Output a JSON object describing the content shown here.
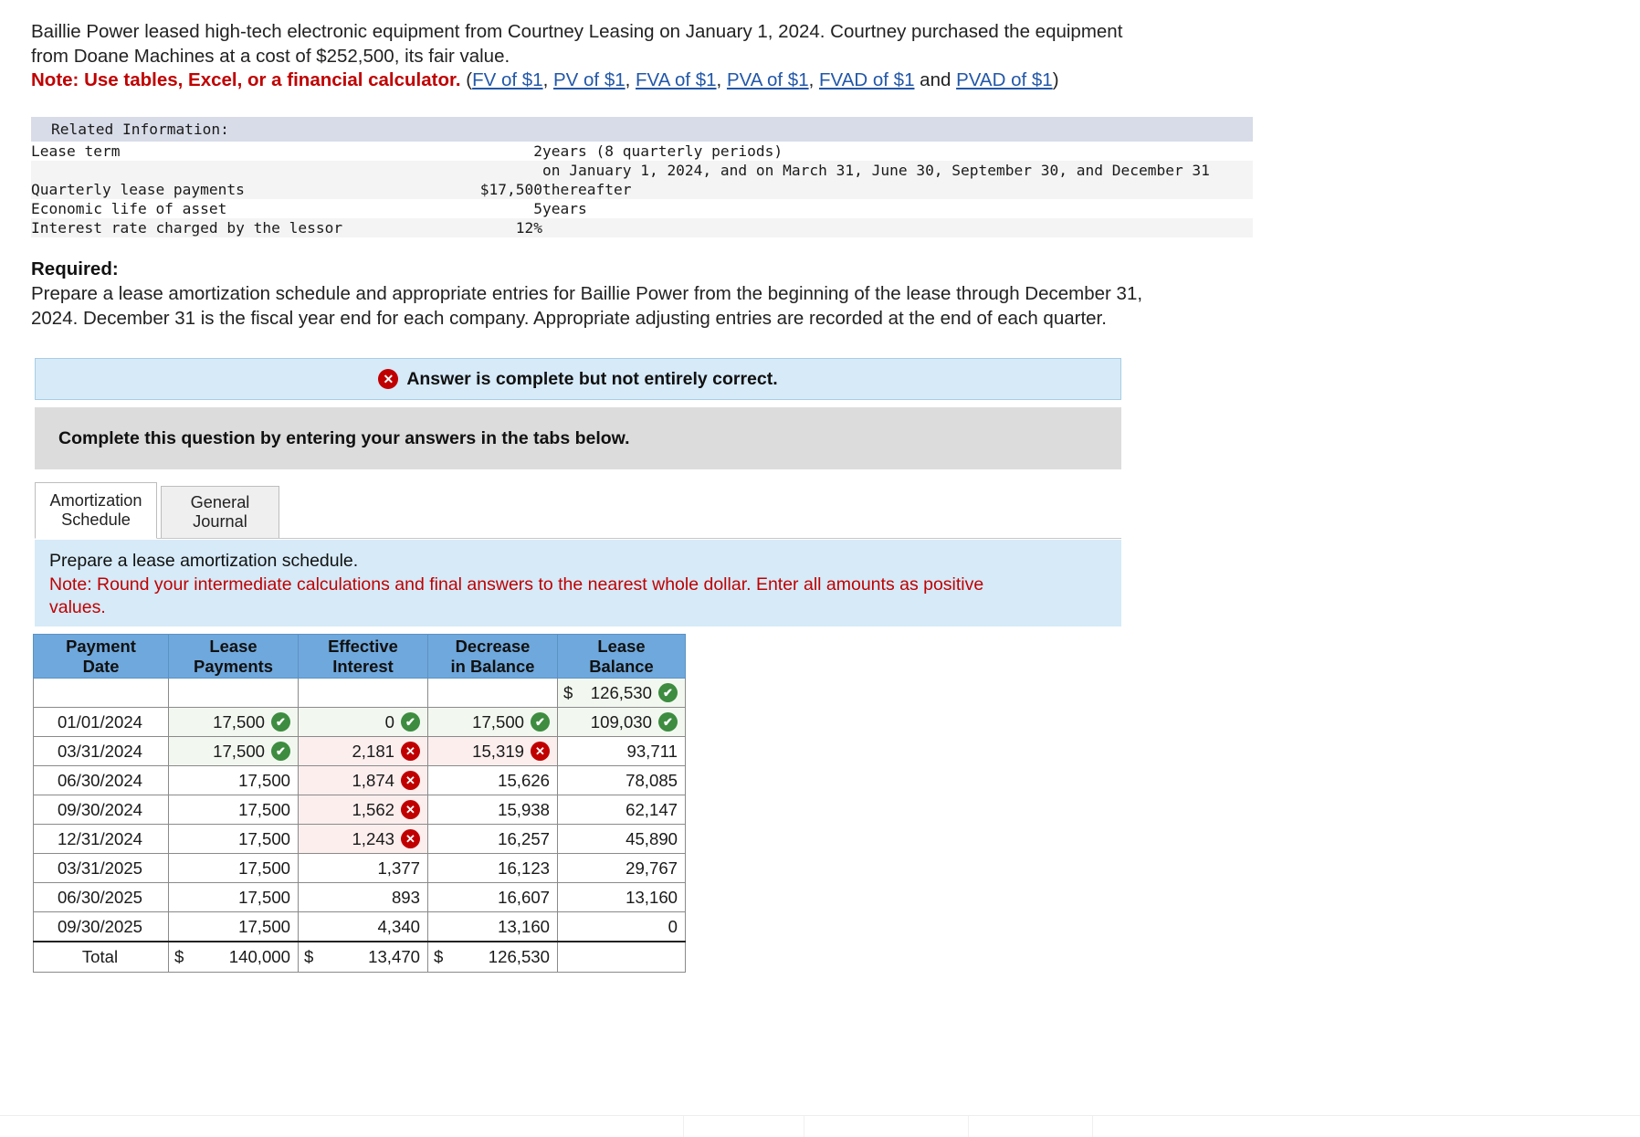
{
  "intro": {
    "line1": "Baillie Power leased high-tech electronic equipment from Courtney Leasing on January 1, 2024. Courtney purchased the equipment",
    "line2": "from Doane Machines at a cost of $252,500, its fair value.",
    "note_label": "Note: Use tables, Excel, or a financial calculator.",
    "paren_open": "(",
    "paren_close": ")",
    "and_text": " and ",
    "links": [
      "FV of $1",
      "PV of $1",
      "FVA of $1",
      "PVA of $1",
      "FVAD of $1",
      "PVAD of $1"
    ],
    "link_color": "#2257a8",
    "note_color": "#c00000"
  },
  "related_information": {
    "title": "Related Information:",
    "rows": [
      {
        "label": "Lease term",
        "amount": "2",
        "rest": "years (8 quarterly periods)"
      },
      {
        "label": "",
        "amount": "",
        "rest": "on January 1, 2024, and on March 31, June 30, September 30, and December 31"
      },
      {
        "label": "Quarterly lease payments",
        "amount": "$17,500",
        "rest": "thereafter"
      },
      {
        "label": "Economic life of asset",
        "amount": "5",
        "rest": "years"
      },
      {
        "label": "Interest rate charged by the lessor",
        "amount": "12%",
        "rest": ""
      }
    ]
  },
  "required": {
    "heading": "Required:",
    "line1": "Prepare a lease amortization schedule and appropriate entries for Baillie Power from the beginning of the lease through December 31,",
    "line2": "2024. December 31 is the fiscal year end for each company. Appropriate adjusting entries are recorded at the end of each quarter."
  },
  "answer_banner": {
    "icon": "x-circle-icon",
    "text": "Answer is complete but not entirely correct.",
    "background": "#d6eaf8",
    "icon_color": "#c00000"
  },
  "complete_bar": {
    "text": "Complete this question by entering your answers in the tabs below."
  },
  "tabs": [
    {
      "label_line1": "Amortization",
      "label_line2": "Schedule",
      "active": true
    },
    {
      "label_line1": "General",
      "label_line2": "Journal",
      "active": false
    }
  ],
  "prompt": {
    "line1": "Prepare a lease amortization schedule.",
    "line2": "Note: Round your intermediate calculations and final answers to the nearest whole dollar. Enter all amounts as positive",
    "line3": "values."
  },
  "amortization_table": {
    "headers": [
      {
        "l1": "Payment",
        "l2": "Date"
      },
      {
        "l1": "Lease",
        "l2": "Payments"
      },
      {
        "l1": "Effective",
        "l2": "Interest"
      },
      {
        "l1": "Decrease",
        "l2": "in Balance"
      },
      {
        "l1": "Lease",
        "l2": "Balance"
      }
    ],
    "header_bg": "#6fa8dc",
    "opening_row": {
      "date": "",
      "payments": "",
      "interest": "",
      "decrease": "",
      "balance": "126,530",
      "balance_dollar": "$",
      "balance_state": "correct"
    },
    "rows": [
      {
        "date": "01/01/2024",
        "payments": "17,500",
        "payments_state": "correct",
        "interest": "0",
        "interest_state": "correct",
        "decrease": "17,500",
        "decrease_state": "correct",
        "balance": "109,030",
        "balance_state": "correct"
      },
      {
        "date": "03/31/2024",
        "payments": "17,500",
        "payments_state": "correct",
        "interest": "2,181",
        "interest_state": "wrong",
        "decrease": "15,319",
        "decrease_state": "wrong",
        "balance": "93,711",
        "balance_state": "plain"
      },
      {
        "date": "06/30/2024",
        "payments": "17,500",
        "payments_state": "plain",
        "interest": "1,874",
        "interest_state": "wrong",
        "decrease": "15,626",
        "decrease_state": "plain",
        "balance": "78,085",
        "balance_state": "plain"
      },
      {
        "date": "09/30/2024",
        "payments": "17,500",
        "payments_state": "plain",
        "interest": "1,562",
        "interest_state": "wrong",
        "decrease": "15,938",
        "decrease_state": "plain",
        "balance": "62,147",
        "balance_state": "plain"
      },
      {
        "date": "12/31/2024",
        "payments": "17,500",
        "payments_state": "plain",
        "interest": "1,243",
        "interest_state": "wrong",
        "decrease": "16,257",
        "decrease_state": "plain",
        "balance": "45,890",
        "balance_state": "plain"
      },
      {
        "date": "03/31/2025",
        "payments": "17,500",
        "payments_state": "plain",
        "interest": "1,377",
        "interest_state": "plain",
        "decrease": "16,123",
        "decrease_state": "plain",
        "balance": "29,767",
        "balance_state": "plain"
      },
      {
        "date": "06/30/2025",
        "payments": "17,500",
        "payments_state": "plain",
        "interest": "893",
        "interest_state": "plain",
        "decrease": "16,607",
        "decrease_state": "plain",
        "balance": "13,160",
        "balance_state": "plain"
      },
      {
        "date": "09/30/2025",
        "payments": "17,500",
        "payments_state": "plain",
        "interest": "4,340",
        "interest_state": "plain",
        "decrease": "13,160",
        "decrease_state": "plain",
        "balance": "0",
        "balance_state": "plain"
      }
    ],
    "total_row": {
      "label": "Total",
      "payments": "140,000",
      "interest": "13,470",
      "decrease": "126,530",
      "dollar": "$",
      "balance": ""
    },
    "marks": {
      "correct_glyph": "✔",
      "wrong_glyph": "✕",
      "correct_color": "#3d8c40",
      "wrong_color": "#c00000"
    }
  }
}
